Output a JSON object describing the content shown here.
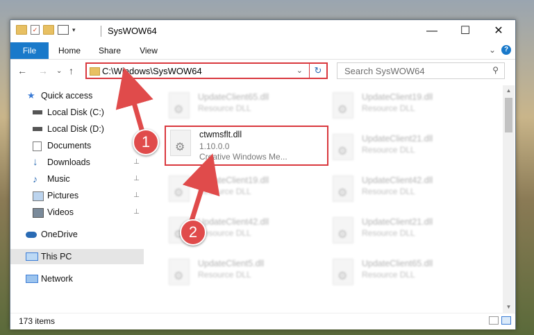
{
  "window": {
    "title": "SysWOW64",
    "minimize_glyph": "—",
    "maximize_glyph": "☐",
    "close_glyph": "✕"
  },
  "ribbon": {
    "tabs": [
      {
        "label": "File"
      },
      {
        "label": "Home"
      },
      {
        "label": "Share"
      },
      {
        "label": "View"
      }
    ],
    "expand_glyph": "⌄",
    "help_glyph": "?"
  },
  "nav": {
    "back_glyph": "←",
    "forward_glyph": "→",
    "recent_glyph": "⌄",
    "up_glyph": "↑",
    "address": "C:\\Windows\\SysWOW64",
    "refresh_glyph": "↻",
    "search_placeholder": "Search SysWOW64"
  },
  "sidebar": {
    "items": [
      {
        "label": "Quick access",
        "icon": "star-icon"
      },
      {
        "label": "Local Disk (C:)",
        "icon": "drive-icon"
      },
      {
        "label": "Local Disk (D:)",
        "icon": "drive-icon"
      },
      {
        "label": "Documents",
        "icon": "documents-icon",
        "pinned": true
      },
      {
        "label": "Downloads",
        "icon": "download-icon",
        "pinned": true
      },
      {
        "label": "Music",
        "icon": "music-icon",
        "pinned": true
      },
      {
        "label": "Pictures",
        "icon": "pictures-icon",
        "pinned": true
      },
      {
        "label": "Videos",
        "icon": "videos-icon",
        "pinned": true
      },
      {
        "label": "OneDrive",
        "icon": "cloud-icon"
      },
      {
        "label": "This PC",
        "icon": "computer-icon",
        "selected": true
      },
      {
        "label": "Network",
        "icon": "network-icon"
      }
    ],
    "pin_glyph": "📌"
  },
  "files": {
    "left": [
      {
        "name": "UpdateClient65.dll",
        "desc": "Resource DLL"
      },
      {
        "name": "ctwmsflt.dll",
        "version": "1.10.0.0",
        "desc": "Creative Windows Me..."
      },
      {
        "name": "UpdateClient19.dll",
        "desc": "Resource DLL"
      },
      {
        "name": "UpdateClient42.dll",
        "desc": "Resource DLL"
      },
      {
        "name": "UpdateClient5.dll",
        "desc": "Resource DLL"
      }
    ],
    "right": [
      {
        "name": "UpdateClient19.dll",
        "desc": "Resource DLL"
      },
      {
        "name": "UpdateClient21.dll",
        "desc": "Resource DLL"
      },
      {
        "name": "UpdateClient42.dll",
        "desc": "Resource DLL"
      },
      {
        "name": "UpdateClient21.dll",
        "desc": "Resource DLL"
      },
      {
        "name": "UpdateClient65.dll",
        "desc": "Resource DLL"
      }
    ]
  },
  "status": {
    "item_count": "173 items"
  },
  "annotations": {
    "step1": "1",
    "step2": "2",
    "color": "#e04b4b"
  }
}
